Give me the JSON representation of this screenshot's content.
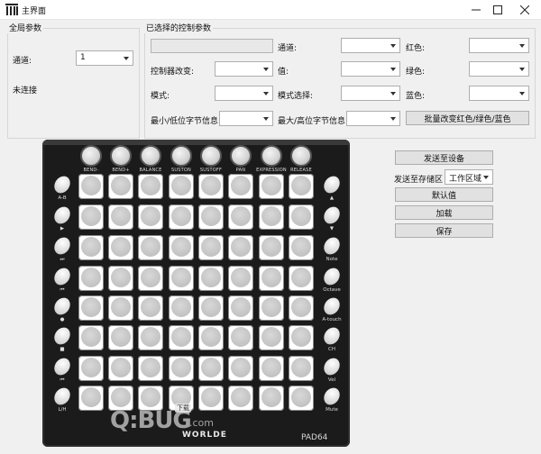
{
  "window": {
    "title": "主界面"
  },
  "global_group": {
    "title": "全局参数",
    "channel_label": "通道:",
    "channel_value": "1",
    "status": "未连接"
  },
  "control_group": {
    "title": "已选择的控制参数",
    "channel_label": "通道:",
    "red_label": "红色:",
    "controller_change_label": "控制器改变:",
    "value_label": "值:",
    "green_label": "绿色:",
    "mode_label": "模式:",
    "mode_select_label": "模式选择:",
    "blue_label": "蓝色:",
    "min_byte_label": "最小/低位字节信息:",
    "max_byte_label": "最大/高位字节信息:",
    "batch_button": "批量改变红色/绿色/蓝色"
  },
  "actions": {
    "send_to_device": "发送至设备",
    "send_to_storage_label": "发送至存储区",
    "storage_value": "工作区域",
    "default": "默认值",
    "load": "加载",
    "save": "保存"
  },
  "device": {
    "brand": "WORLDE",
    "model": "PAD64",
    "knob_labels": [
      "BEND-",
      "BEND+",
      "BALANCE",
      "SUSTON",
      "SUSTOFF",
      "PAN",
      "EXPRESSION",
      "RELEASE"
    ],
    "left_labels": [
      "A-B",
      "▶",
      "⏭",
      "⏮",
      "●",
      "■",
      "⏮",
      "L/H"
    ],
    "right_labels": [
      "▲",
      "▼",
      "Note",
      "Octave",
      "A-touch",
      "CH",
      "Vel",
      "Mute"
    ]
  },
  "watermark": {
    "text": "Q:BUG",
    "suffix": ".com",
    "badge": "下载"
  }
}
